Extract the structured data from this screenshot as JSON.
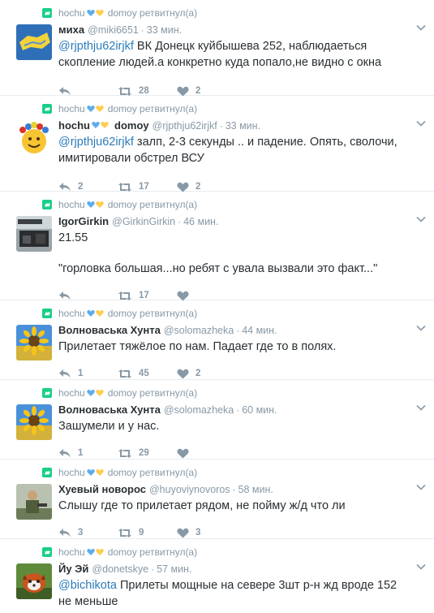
{
  "timeline": {
    "tweets": [
      {
        "retweeter": "hochu",
        "retweet_suffix": "domoy ретвитнул(а)",
        "fullname": "миха",
        "screen_name": "@miki6651",
        "time": "33 мин.",
        "mention": "@rjpthju62irjkf",
        "text": " ВК  Донецк  куйбышева 252, наблюдаеться скопление людей.а конкретно куда попало,не видно с окна",
        "reply_count": "",
        "retweet_count": "28",
        "like_count": "2"
      },
      {
        "retweeter": "hochu",
        "retweet_suffix": "domoy ретвитнул(а)",
        "fullname": "hochu",
        "fullname_after": "domoy",
        "screen_name": "@rjpthju62irjkf",
        "time": "33 мин.",
        "mention": "@rjpthju62irjkf",
        "text": " залп, 2-3 секунды .. и падение. Опять, сволочи, имитировали обстрел ВСУ",
        "reply_count": "2",
        "retweet_count": "17",
        "like_count": "2"
      },
      {
        "retweeter": "hochu",
        "retweet_suffix": "domoy ретвитнул(а)",
        "fullname": "IgorGirkin",
        "screen_name": "@GirkinGirkin",
        "time": "46 мин.",
        "text_line1": "21.55",
        "text_line2": "\"горловка большая...но ребят с увала вызвали это факт...\"",
        "reply_count": "",
        "retweet_count": "17",
        "like_count": ""
      },
      {
        "retweeter": "hochu",
        "retweet_suffix": "domoy ретвитнул(а)",
        "fullname": "Волноваська Хунта",
        "screen_name": "@solomazheka",
        "time": "44 мин.",
        "text": "Прилетает тяжёлое по нам. Падает где то  в полях.",
        "reply_count": "1",
        "retweet_count": "45",
        "like_count": "2"
      },
      {
        "retweeter": "hochu",
        "retweet_suffix": "domoy ретвитнул(а)",
        "fullname": "Волноваська Хунта",
        "screen_name": "@solomazheka",
        "time": "60 мин.",
        "text": "Зашумели и у нас.",
        "reply_count": "1",
        "retweet_count": "29",
        "like_count": ""
      },
      {
        "retweeter": "hochu",
        "retweet_suffix": "domoy ретвитнул(а)",
        "fullname": "Хуевый новорос",
        "screen_name": "@huyoviynovoros",
        "time": "58 мин.",
        "text": "Слышу где то прилетает рядом, не пойму ж/д что ли",
        "reply_count": "3",
        "retweet_count": "9",
        "like_count": "3"
      },
      {
        "retweeter": "hochu",
        "retweet_suffix": "domoy ретвитнул(а)",
        "fullname": "Йу Эй",
        "screen_name": "@donetskye",
        "time": "57 мин.",
        "mention": "@bichikota",
        "text": " Прилеты мощные на севере 3шт р-н жд вроде 152 не меньше",
        "reply_count": "",
        "retweet_count": "",
        "like_count": ""
      }
    ]
  },
  "icons": {
    "retweet_badge": "retweet-icon",
    "reply": "reply-icon",
    "retweet": "retweet-icon",
    "like": "heart-icon",
    "caret": "chevron-down-icon",
    "hearts": [
      "blue-heart-icon",
      "yellow-heart-icon"
    ]
  },
  "colors": {
    "mention": "#2b7bb9",
    "meta": "#8899a6",
    "retweet_badge": "#19cf86",
    "heart_blue": "#5dadec",
    "heart_yellow": "#ffcc4d"
  }
}
